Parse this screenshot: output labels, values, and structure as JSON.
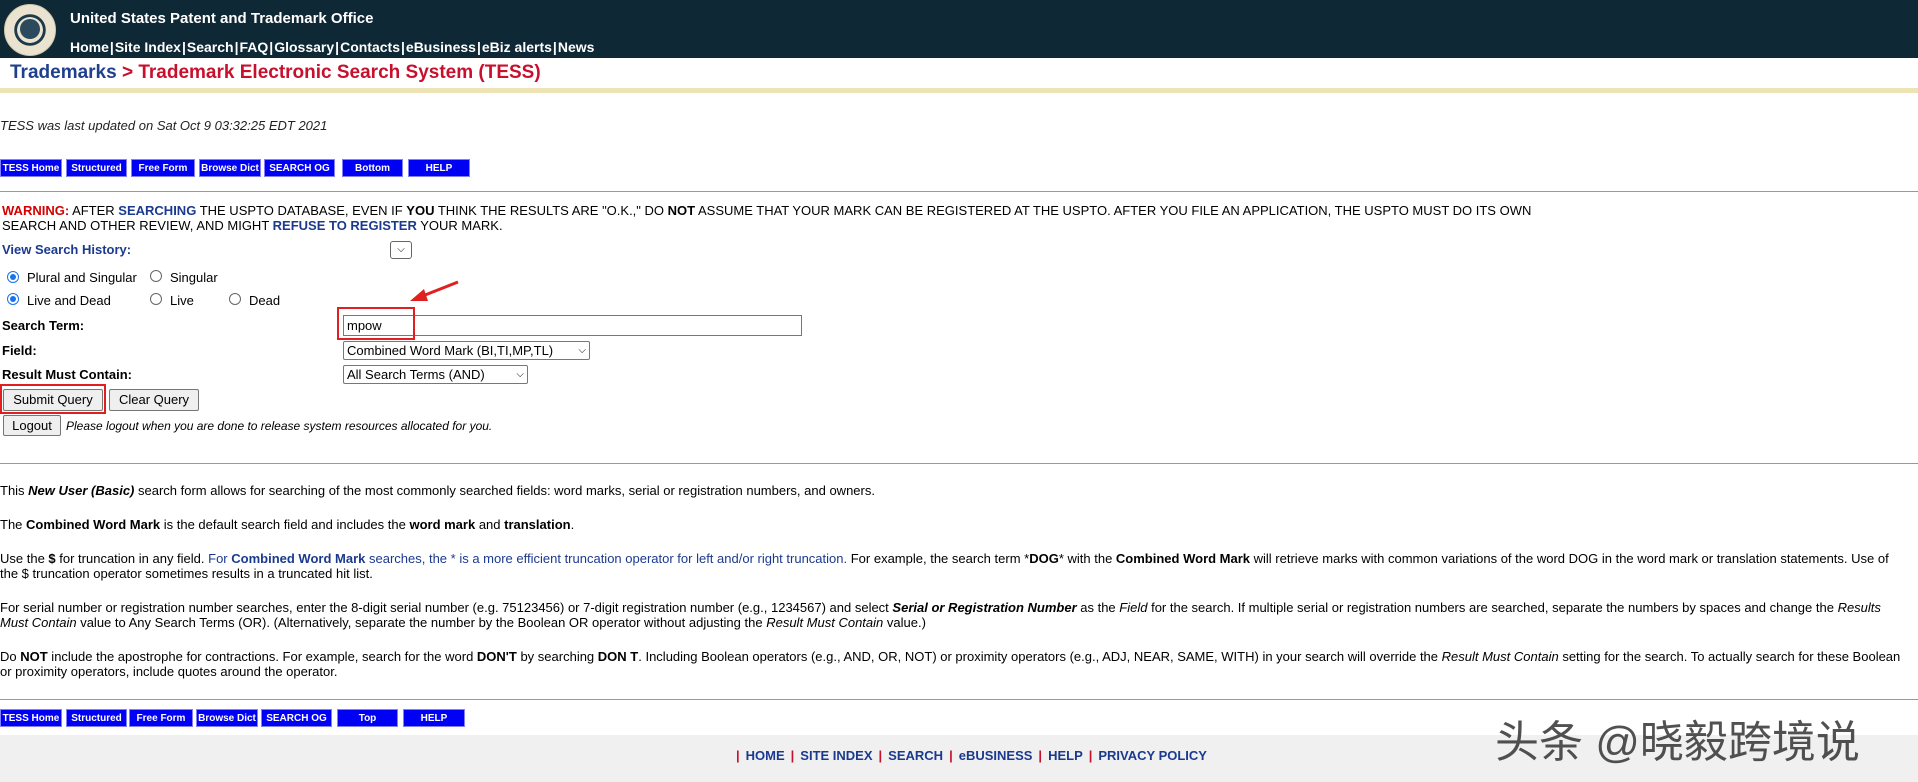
{
  "header": {
    "title": "United States Patent and Trademark Office",
    "nav": [
      "Home",
      "Site Index",
      "Search",
      "FAQ",
      "Glossary",
      "Contacts",
      "eBusiness",
      "eBiz alerts",
      "News"
    ]
  },
  "breadcrumb": {
    "root": "Trademarks",
    "sep": " > ",
    "current": "Trademark Electronic Search System (TESS)"
  },
  "updated": "TESS was last updated on Sat Oct 9 03:32:25 EDT 2021",
  "top_buttons": [
    "TESS Home",
    "Structured",
    "Free Form",
    "Browse Dict",
    "SEARCH OG",
    "Bottom",
    "HELP"
  ],
  "bottom_buttons": [
    "TESS Home",
    "Structured",
    "Free Form",
    "Browse Dict",
    "SEARCH OG",
    "Top",
    "HELP"
  ],
  "warning": {
    "w1": "WARNING:",
    "t1": " AFTER ",
    "w2": "SEARCHING",
    "t2": " THE USPTO DATABASE, EVEN IF ",
    "w3": "YOU",
    "t3": " THINK THE RESULTS ARE \"O.K.,\" DO ",
    "w4": "NOT",
    "t4": " ASSUME THAT YOUR MARK CAN BE REGISTERED AT THE USPTO. AFTER YOU FILE AN APPLICATION, THE USPTO MUST DO ITS OWN SEARCH AND OTHER REVIEW, AND MIGHT ",
    "w5": "REFUSE TO REGISTER",
    "t5": " YOUR MARK."
  },
  "form": {
    "history_label": "View Search History:",
    "plural_singular": "Plural and Singular",
    "singular": "Singular",
    "live_dead": "Live and Dead",
    "live": "Live",
    "dead": "Dead",
    "search_term_label": "Search Term:",
    "search_term_value": "mpow",
    "field_label": "Field:",
    "field_value": "Combined Word Mark (BI,TI,MP,TL)",
    "result_label": "Result Must Contain:",
    "result_value": "All Search Terms (AND)",
    "submit": "Submit Query",
    "clear": "Clear Query",
    "logout": "Logout",
    "logout_note": "Please logout when you are done to release system resources allocated for you."
  },
  "info": {
    "p1a": "This ",
    "p1b": "New User (Basic)",
    "p1c": " search form allows for searching of the most commonly searched fields: word marks, serial or registration numbers, and owners.",
    "p2a": "The ",
    "p2b": "Combined Word Mark",
    "p2c": " is the default search field and includes the ",
    "p2d": "word mark",
    "p2e": " and ",
    "p2f": "translation",
    "p2g": ".",
    "p3a": "Use the ",
    "p3b": "$",
    "p3c": " for truncation in any field. ",
    "p3d": "For ",
    "p3e": "Combined Word Mark",
    "p3f": " searches, the * is a more efficient truncation operator for left and/or right truncation.",
    "p3g": " For example, the search term *",
    "p3h": "DOG",
    "p3i": "* with the ",
    "p3j": "Combined Word Mark",
    "p3k": " will retrieve marks with common variations of the word DOG in the word mark or translation statements. Use of the $ truncation operator sometimes results in a truncated hit list.",
    "p4a": "For serial number or registration number searches, enter the 8-digit serial number (e.g. 75123456) or 7-digit registration number (e.g., 1234567) and select ",
    "p4b": "Serial or Registration Number",
    "p4c": " as the ",
    "p4d": "Field",
    "p4e": " for the search. If multiple serial or registration numbers are searched, separate the numbers by spaces and change the ",
    "p4f": "Results Must Contain",
    "p4g": " value to Any Search Terms (OR). (Alternatively, separate the number by the Boolean OR operator without adjusting the ",
    "p4h": "Result Must Contain",
    "p4i": " value.)",
    "p5a": "Do ",
    "p5b": "NOT",
    "p5c": " include the apostrophe for contractions. For example, search for the word ",
    "p5d": "DON'T",
    "p5e": " by searching ",
    "p5f": "DON T",
    "p5g": ". Including Boolean operators (e.g., AND, OR, NOT) or proximity operators (e.g., ADJ, NEAR, SAME, WITH) in your search will override the ",
    "p5h": "Result Must Contain",
    "p5i": " setting for the search. To actually search for these Boolean or proximity operators, include quotes around the operator."
  },
  "footer": [
    "HOME",
    "SITE INDEX",
    "SEARCH",
    "eBUSINESS",
    "HELP",
    "PRIVACY POLICY"
  ],
  "watermark": "头条 @晓毅跨境说",
  "colors": {
    "header_bg": "#0f2835",
    "tess_button": "#0000f5",
    "warning_red": "#d40000",
    "link_blue": "#1b3a8f",
    "annotation_red": "#e02020"
  }
}
